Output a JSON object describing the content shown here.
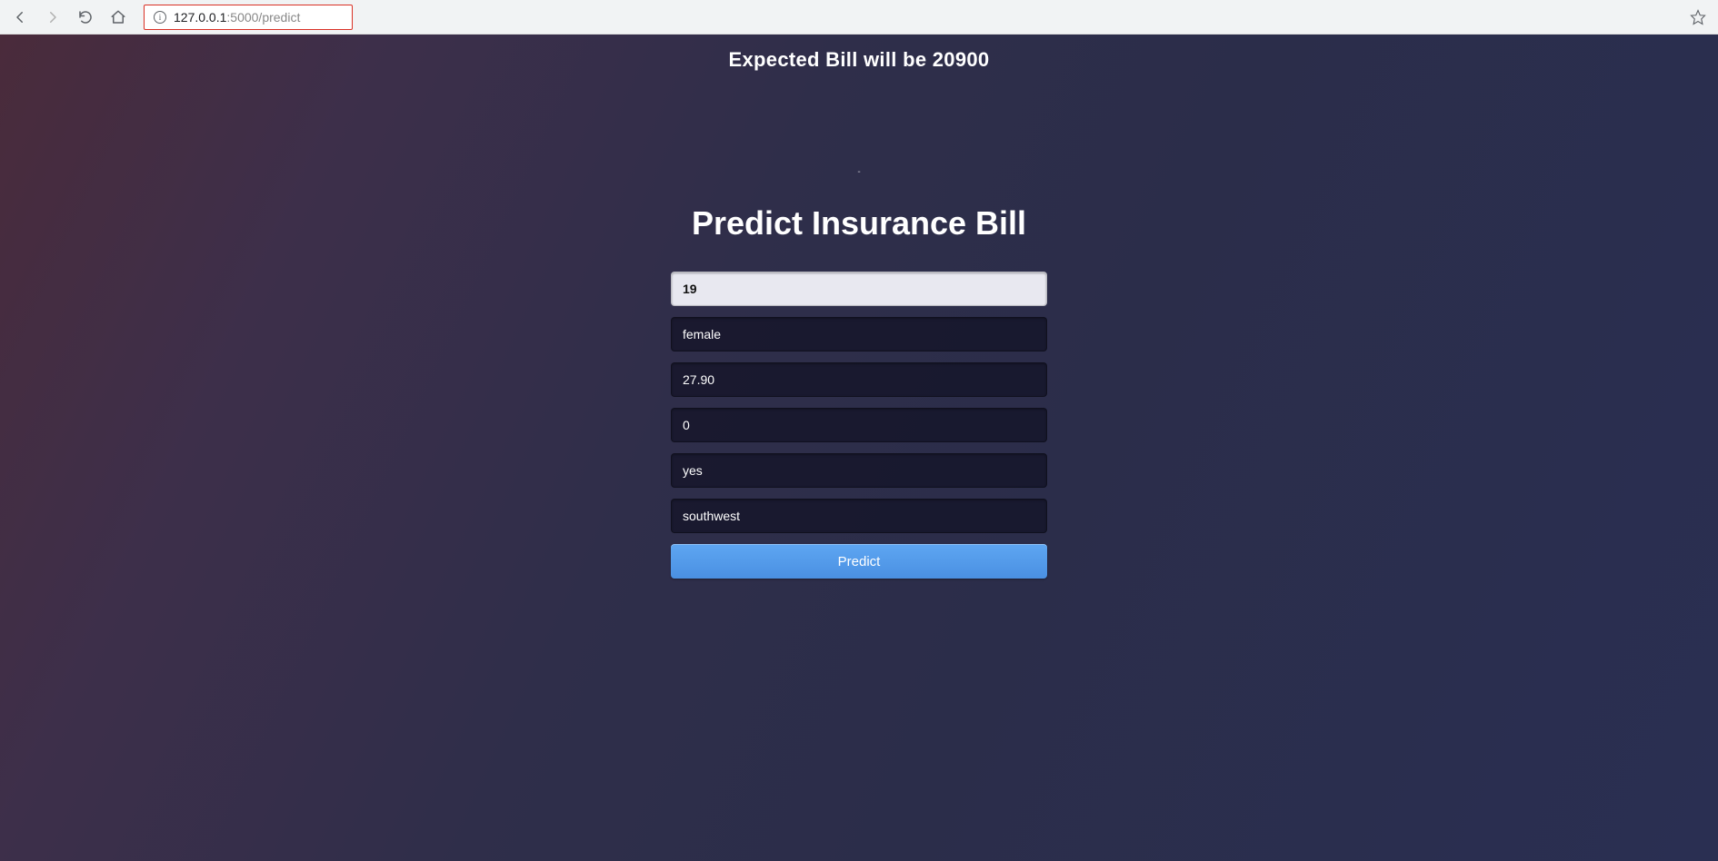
{
  "browser": {
    "url_host": "127.0.0.1",
    "url_port_path": ":5000/predict"
  },
  "result": {
    "text": "Expected Bill will be 20900"
  },
  "form": {
    "dash": "-",
    "title": "Predict Insurance Bill",
    "age": "19",
    "sex": "female",
    "bmi": "27.90",
    "children": "0",
    "smoker": "yes",
    "region": "southwest",
    "submit_label": "Predict"
  }
}
